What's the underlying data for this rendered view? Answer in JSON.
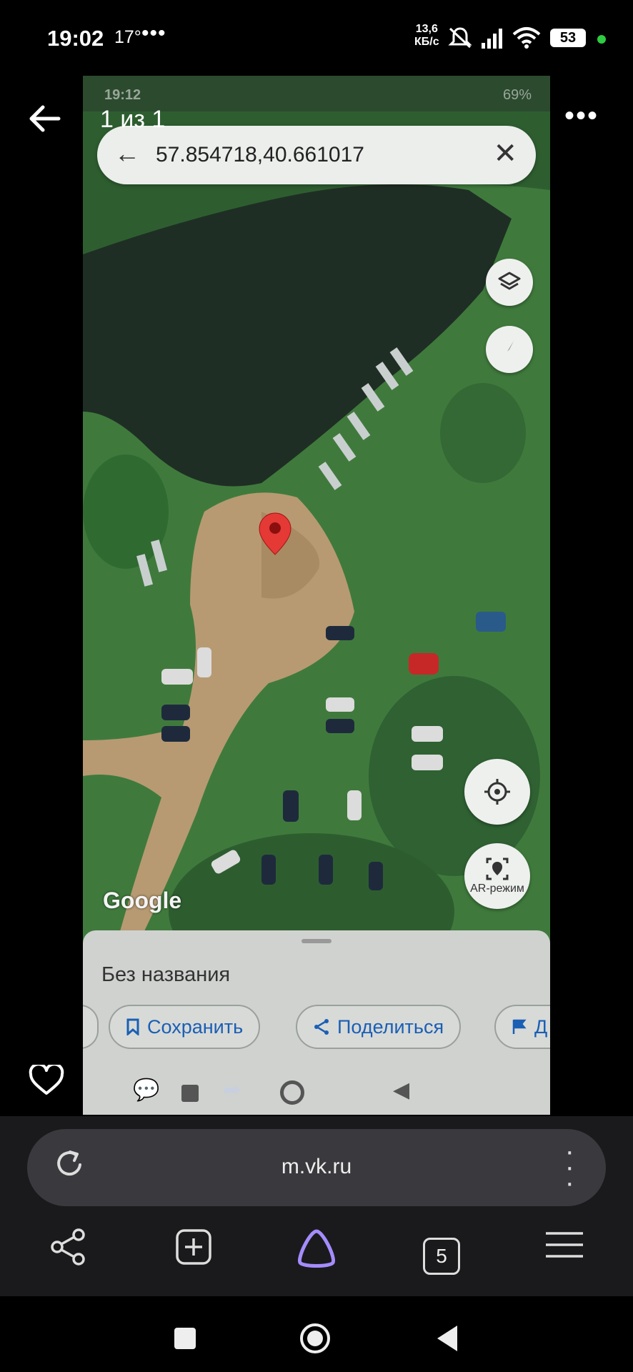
{
  "status_bar": {
    "time": "19:02",
    "temp": "17°",
    "speed_top": "13,6",
    "speed_bottom": "КБ/с",
    "battery": "53",
    "icons": [
      "mute-icon",
      "signal-icon",
      "wifi-icon",
      "battery-icon"
    ]
  },
  "viewer": {
    "counter": "1 из 1"
  },
  "screenshot": {
    "status_bar": {
      "time": "19:12",
      "battery": "69%"
    },
    "search": {
      "coords": "57.854718,40.661017"
    },
    "map_attribution": "Google",
    "ar_label": "AR-режим",
    "sheet": {
      "title": "Без названия",
      "chips": [
        {
          "label": "Сохранить",
          "icon": "bookmark-icon"
        },
        {
          "label": "Поделиться",
          "icon": "share-icon"
        },
        {
          "label": "Д",
          "icon": "flag-icon"
        }
      ]
    }
  },
  "browser": {
    "url": "m.vk.ru",
    "tab_count": "5"
  },
  "colors": {
    "map_water": "#1f2e24",
    "map_grass": "#3f7a3c",
    "map_dirt": "#b79a72",
    "pin": "#e53935",
    "link_blue": "#1a5fb4",
    "alice_purple": "#a58cff"
  }
}
